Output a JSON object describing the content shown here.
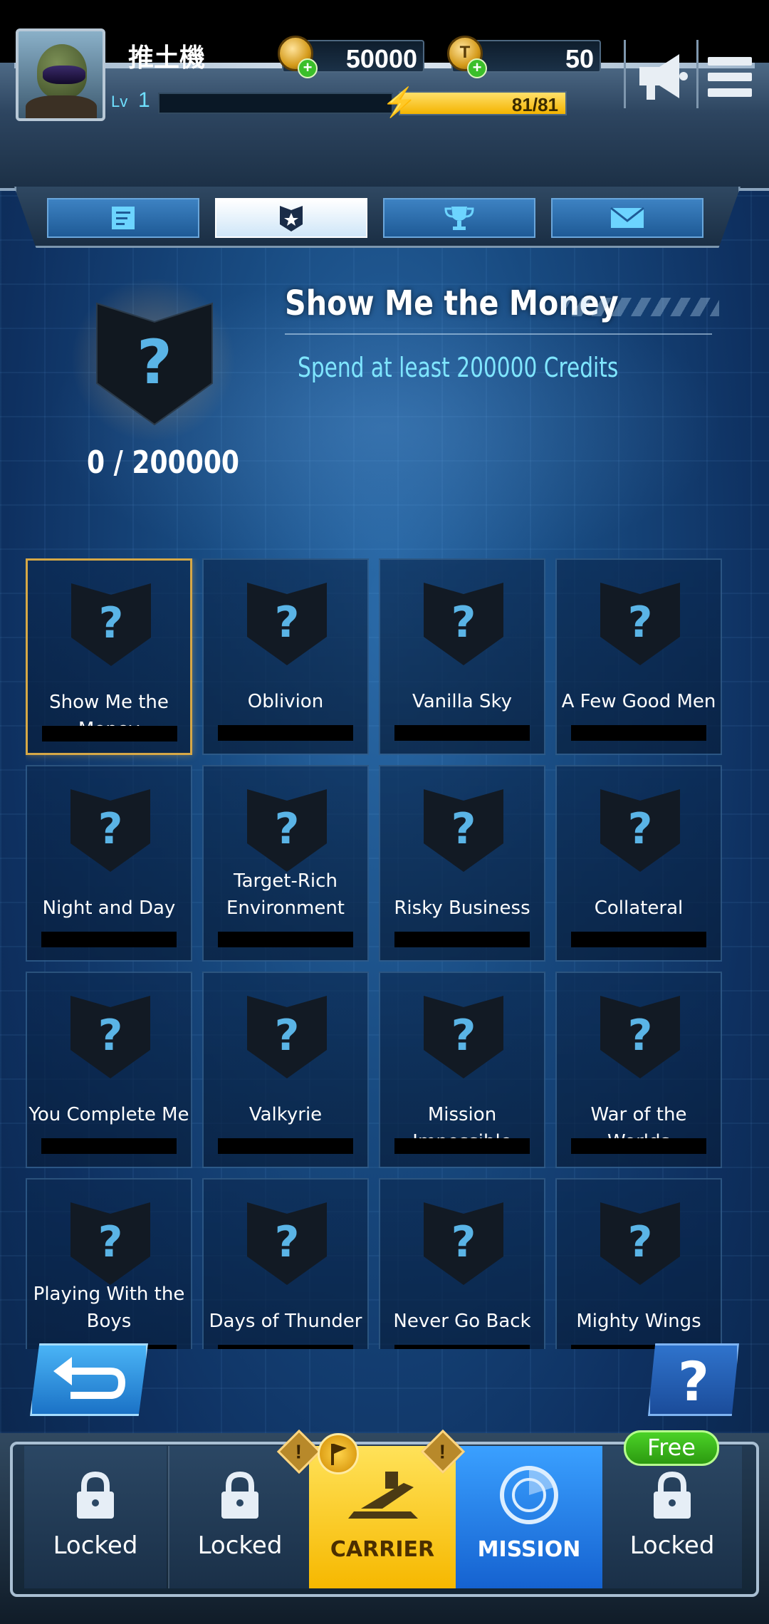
{
  "player": {
    "name": "推土機",
    "level_label": "Lv",
    "level": "1"
  },
  "currency": {
    "credits": "50000",
    "tokens": "50",
    "energy": "81/81",
    "energy_fraction": 1.0,
    "tokens_glyph": "T"
  },
  "tabs": [
    {
      "icon": "list-icon",
      "active": false
    },
    {
      "icon": "medal-icon",
      "active": true
    },
    {
      "icon": "trophy-icon",
      "active": false
    },
    {
      "icon": "mail-icon",
      "active": false
    }
  ],
  "detail": {
    "title": "Show Me the Money",
    "description": "Spend at least 200000 Credits",
    "progress": "0 / 200000",
    "badge_symbol": "?"
  },
  "achievements": [
    {
      "name": "Show Me the Money",
      "selected": true
    },
    {
      "name": "Oblivion"
    },
    {
      "name": "Vanilla Sky"
    },
    {
      "name": "A Few Good Men"
    },
    {
      "name": "Night and Day"
    },
    {
      "name": "Target-Rich Environment",
      "line1": "Target-Rich",
      "line2": "Environment"
    },
    {
      "name": "Risky Business"
    },
    {
      "name": "Collateral"
    },
    {
      "name": "You Complete Me"
    },
    {
      "name": "Valkyrie"
    },
    {
      "name": "Mission Impossible"
    },
    {
      "name": "War of the Worlds"
    },
    {
      "name": "Playing With the Boys",
      "line1": "Playing With the",
      "line2": "Boys"
    },
    {
      "name": "Days of Thunder"
    },
    {
      "name": "Never Go Back"
    },
    {
      "name": "Mighty Wings"
    }
  ],
  "buttons": {
    "help": "?"
  },
  "bottom_nav": [
    {
      "label": "Locked",
      "type": "locked"
    },
    {
      "label": "Locked",
      "type": "locked"
    },
    {
      "label": "CARRIER",
      "type": "carrier"
    },
    {
      "label": "MISSION",
      "type": "mission"
    },
    {
      "label": "Locked",
      "type": "locked"
    }
  ],
  "badges": {
    "free": "Free",
    "warning": "!"
  },
  "colors": {
    "accent_cyan": "#7fe6ff",
    "carrier_yellow": "#f6b800",
    "mission_blue": "#1562d0",
    "free_green": "#2c9a10"
  }
}
